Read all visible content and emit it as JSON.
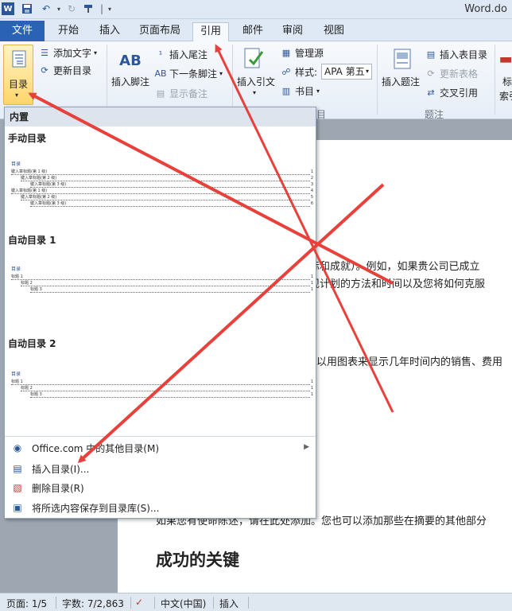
{
  "window": {
    "title": "Word.do"
  },
  "quick_access": {
    "save_icon": "save-icon",
    "undo_icon": "undo-icon",
    "redo_icon": "redo-icon",
    "format_icon": "format-painter-icon",
    "separator": "|"
  },
  "tabs": [
    {
      "label": "文件"
    },
    {
      "label": "开始"
    },
    {
      "label": "插入"
    },
    {
      "label": "页面布局"
    },
    {
      "label": "引用"
    },
    {
      "label": "邮件"
    },
    {
      "label": "审阅"
    },
    {
      "label": "视图"
    }
  ],
  "ribbon": {
    "toc": {
      "label": "目录",
      "add_text": "添加文字",
      "update_toc": "更新目录"
    },
    "footnotes": {
      "insert_footnote": "插入脚注",
      "big_icon_text": "AB",
      "insert_endnote": "插入尾注",
      "next_footnote": "下一条脚注",
      "show_notes": "显示备注"
    },
    "citations": {
      "insert_citation": "插入引文",
      "manage_sources": "管理源",
      "style_label": "样式:",
      "style_value": "APA 第五",
      "bibliography": "书目",
      "group_label": "目"
    },
    "captions": {
      "insert_caption": "插入题注",
      "insert_table_figures": "插入表目录",
      "update_table": "更新表格",
      "cross_reference": "交叉引用",
      "group_label": "题注"
    },
    "index": {
      "label_top": "标",
      "label_bottom": "索引"
    }
  },
  "document": {
    "line1": "目标和成就）。例如，如果贵公司已成立",
    "line2": "实现计划的方法和时间以及您将如何克服",
    "line3": "以用图表来显示几年时间内的销售、费用",
    "line4": "如果您有使命陈述，请在此处添加。您也可以添加那些在摘要的其他部分",
    "heading": "成功的关键"
  },
  "dropdown": {
    "header": "内置",
    "galleries": [
      {
        "title": "手动目录",
        "preview_title": "目录",
        "lines": [
          {
            "text": "键入章标题(第 1 级)",
            "page": "1",
            "level": 1
          },
          {
            "text": "键入章标题(第 2 级)",
            "page": "2",
            "level": 2
          },
          {
            "text": "键入章标题(第 3 级)",
            "page": "3",
            "level": 3
          },
          {
            "text": "键入章标题(第 1 级)",
            "page": "4",
            "level": 1
          },
          {
            "text": "键入章标题(第 2 级)",
            "page": "5",
            "level": 2
          },
          {
            "text": "键入章标题(第 3 级)",
            "page": "6",
            "level": 3
          }
        ]
      },
      {
        "title": "自动目录 1",
        "preview_title": "目录",
        "lines": [
          {
            "text": "标题 1",
            "page": "1",
            "level": 1
          },
          {
            "text": "标题 2",
            "page": "1",
            "level": 2
          },
          {
            "text": "标题 3",
            "page": "1",
            "level": 3
          }
        ]
      },
      {
        "title": "自动目录 2",
        "preview_title": "目录",
        "lines": [
          {
            "text": "标题 1",
            "page": "1",
            "level": 1
          },
          {
            "text": "标题 2",
            "page": "1",
            "level": 2
          },
          {
            "text": "标题 3",
            "page": "1",
            "level": 3
          }
        ]
      }
    ],
    "menu_items": [
      {
        "label": "Office.com 中的其他目录(M)",
        "icon": "office-globe-icon",
        "has_submenu": true
      },
      {
        "label": "插入目录(I)...",
        "icon": "insert-toc-icon",
        "has_submenu": false
      },
      {
        "label": "删除目录(R)",
        "icon": "remove-toc-icon",
        "has_submenu": false
      },
      {
        "label": "将所选内容保存到目录库(S)...",
        "icon": "save-to-gallery-icon",
        "has_submenu": false
      }
    ]
  },
  "statusbar": {
    "page": "页面: 1/5",
    "words": "字数: 7/2,863",
    "language": "中文(中国)",
    "mode": "插入",
    "proof_icon": "proofing-icon"
  },
  "annotation": {
    "arrow_color": "#e8413b"
  }
}
